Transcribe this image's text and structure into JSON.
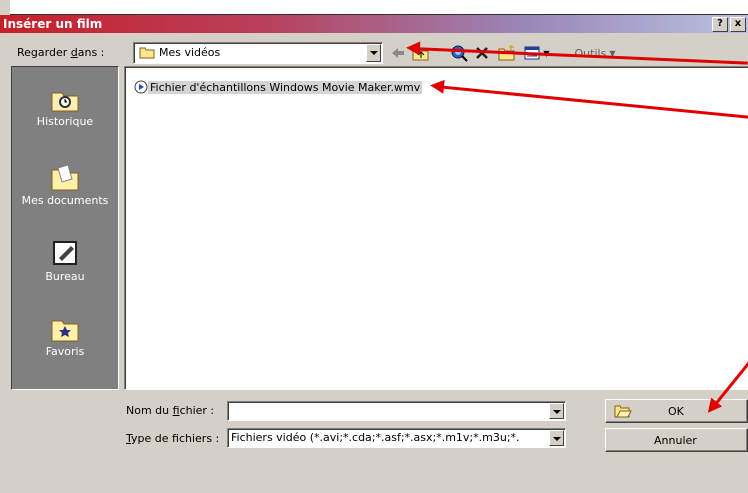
{
  "window": {
    "title": "Insérer un film",
    "help_label": "?",
    "close_label": "x"
  },
  "toolbar": {
    "look_in_label_pre": "Regarder ",
    "look_in_label_u": "d",
    "look_in_label_post": "ans :",
    "look_in_value": "Mes vidéos",
    "tools_label": "Outils"
  },
  "places": [
    {
      "label": "Historique",
      "icon": "history-icon"
    },
    {
      "label": "Mes documents",
      "icon": "my-documents-icon"
    },
    {
      "label": "Bureau",
      "icon": "desktop-icon"
    },
    {
      "label": "Favoris",
      "icon": "favorites-icon"
    }
  ],
  "files": [
    {
      "name": "Fichier d'échantillons Windows Movie Maker.wmv",
      "icon": "video-file-icon"
    }
  ],
  "filename": {
    "label_pre": "Nom du ",
    "label_u": "f",
    "label_post": "ichier :",
    "value": ""
  },
  "filetype": {
    "label_u": "T",
    "label_post": "ype de fichiers :",
    "value": "Fichiers vidéo (*.avi;*.cda;*.asf;*.asx;*.m1v;*.m3u;*."
  },
  "buttons": {
    "ok": "OK",
    "cancel": "Annuler"
  },
  "colors": {
    "annotation_arrow": "#e00000",
    "title_gradient_start": "#c8202a",
    "face": "#d4d0c8"
  }
}
